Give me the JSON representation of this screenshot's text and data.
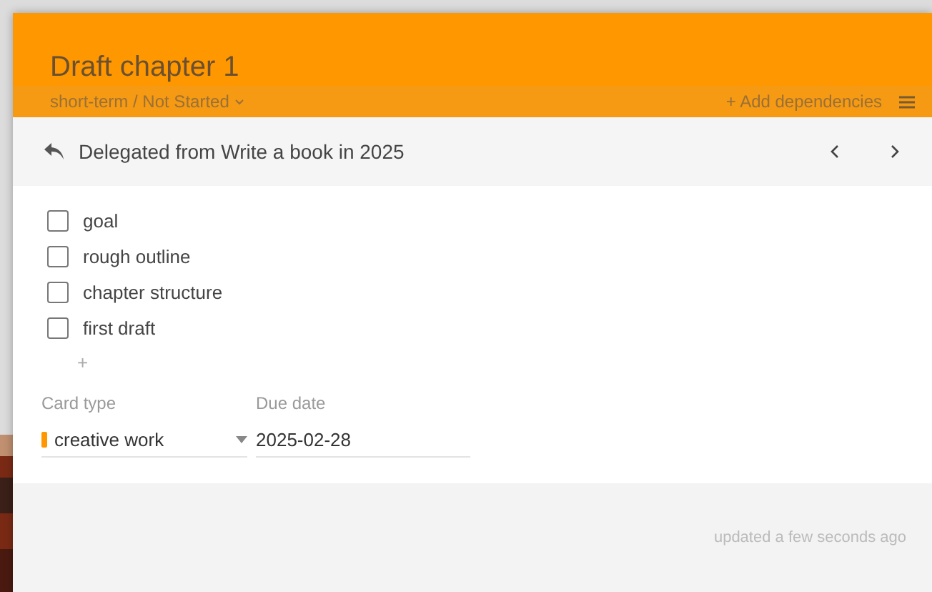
{
  "card": {
    "title": "Draft chapter 1",
    "status": "short-term / Not Started",
    "add_dependencies": "+ Add dependencies"
  },
  "delegated": {
    "text": "Delegated from Write a book in 2025"
  },
  "checklist": [
    {
      "label": "goal",
      "checked": false
    },
    {
      "label": "rough outline",
      "checked": false
    },
    {
      "label": "chapter structure",
      "checked": false
    },
    {
      "label": "first draft",
      "checked": false
    }
  ],
  "add_item": "+",
  "fields": {
    "card_type": {
      "label": "Card type",
      "value": "creative work",
      "color": "#ff9800"
    },
    "due_date": {
      "label": "Due date",
      "value": "2025-02-28"
    }
  },
  "footer": {
    "updated": "updated a few seconds ago"
  }
}
